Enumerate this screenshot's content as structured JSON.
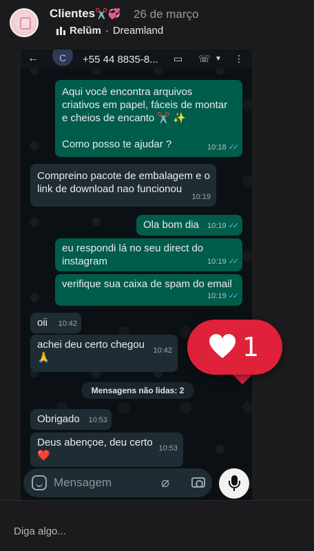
{
  "story": {
    "username": "Clientes",
    "username_emoji": "✂️💞",
    "date": "26 de março",
    "music_song": "Relŭm",
    "music_artist": "Dreamland",
    "like_count": "1",
    "reply_placeholder": "Diga algo..."
  },
  "chat": {
    "phone_number": "+55 44 8835-8...",
    "messages": [
      {
        "direction": "out",
        "text": "Aqui você encontra arquivos\ncriativos em papel, fáceis de montar\ne cheios de encanto ✂️ ✨\n\nComo posso te ajudar ?",
        "time": "10:18",
        "ticks": "✓✓"
      },
      {
        "direction": "in",
        "text": "Compreino pacote de embalagem e o\nlink de download nao funcionou",
        "time": "10:19"
      },
      {
        "direction": "out",
        "text": "Ola bom dia",
        "time": "10:19",
        "ticks": "✓✓"
      },
      {
        "direction": "out",
        "text": "eu respondi lá no seu direct do\ninstagram",
        "time": "10:19",
        "ticks": "✓✓"
      },
      {
        "direction": "out",
        "text": "verifique sua caixa de spam do email",
        "time": "10:19",
        "ticks": "✓✓"
      },
      {
        "direction": "in",
        "text": "oii",
        "time": "10:42"
      },
      {
        "direction": "in",
        "text": "achei deu certo chegou\n🙏",
        "time": "10:42"
      },
      {
        "direction": "in",
        "text": "Obrigado",
        "time": "10:53"
      },
      {
        "direction": "in",
        "text": "Deus abençoe, deu certo\n❤️",
        "time": "10:53"
      }
    ],
    "unread_label": "Mensagens não lidas: 2",
    "input_placeholder": "Mensagem"
  },
  "colors": {
    "outgoing_bubble": "#005c4b",
    "incoming_bubble": "#202c33",
    "like_sticker": "#e0213a",
    "read_ticks": "#53bdeb"
  },
  "icons": [
    "back-arrow-icon",
    "video-call-icon",
    "phone-icon",
    "menu-dots-icon",
    "sticker-icon",
    "attach-icon",
    "camera-icon",
    "mic-icon",
    "heart-icon",
    "music-bars-icon"
  ]
}
